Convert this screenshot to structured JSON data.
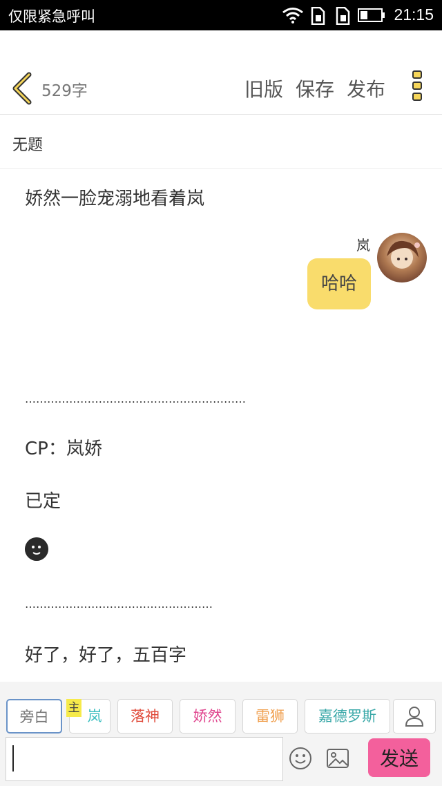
{
  "status_bar": {
    "carrier": "仅限紧急呼叫",
    "time": "21:15"
  },
  "header": {
    "word_count": "529字",
    "actions": [
      "旧版",
      "保存",
      "发布"
    ]
  },
  "document": {
    "title": "无题"
  },
  "content": {
    "lines": [
      "娇然一脸宠溺地看着岚",
      "CP：岚娇",
      "已定",
      "好了，好了，五百字"
    ],
    "chat": {
      "speaker": "岚",
      "message": "哈哈"
    },
    "dots_1": "……………………………………………………",
    "dots_2": "……………………………………………"
  },
  "roles": {
    "main_tag": "主",
    "items": [
      {
        "label": "旁白",
        "color": "#777777"
      },
      {
        "label": "岚",
        "color": "#3bbfc0"
      },
      {
        "label": "落神",
        "color": "#e04a3a"
      },
      {
        "label": "娇然",
        "color": "#e0478f"
      },
      {
        "label": "雷狮",
        "color": "#f0a050"
      },
      {
        "label": "嘉德罗斯",
        "color": "#3aa8a8"
      }
    ]
  },
  "input": {
    "value": "",
    "placeholder": "",
    "send_label": "发送"
  },
  "icons": [
    "wifi-icon",
    "sim1-icon",
    "sim2-icon",
    "battery-icon",
    "back-chevron-icon",
    "more-vertical-icon",
    "add-person-icon",
    "smiley-icon",
    "image-icon"
  ]
}
